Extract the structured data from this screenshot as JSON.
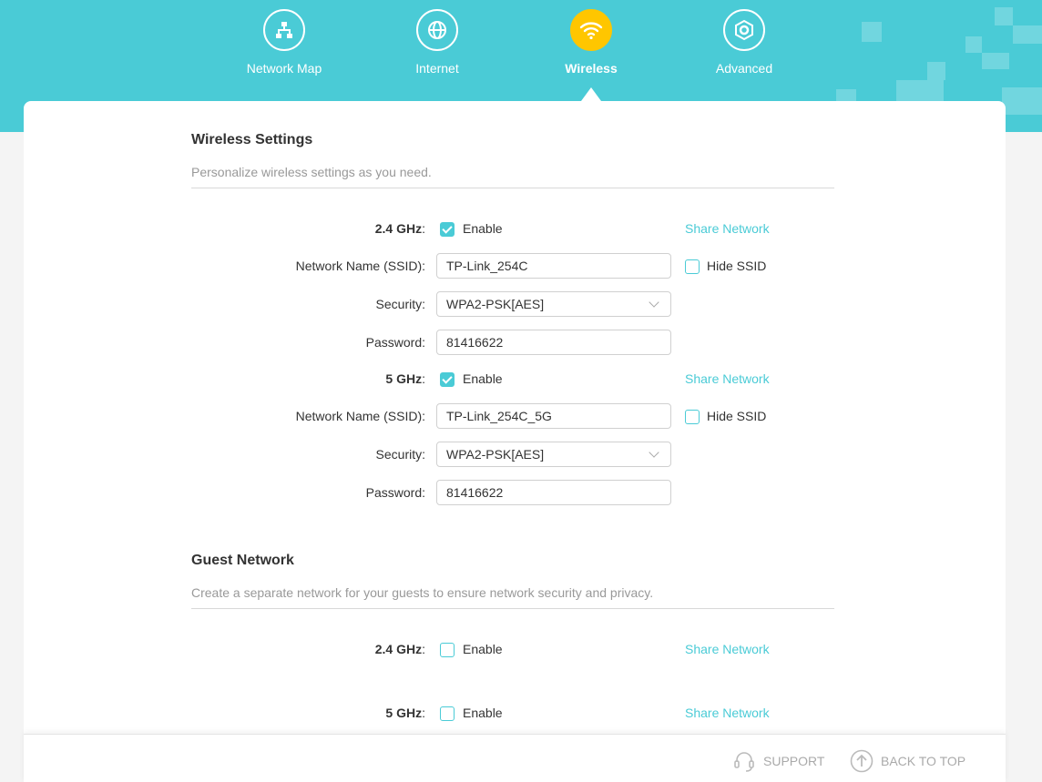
{
  "nav": {
    "items": [
      {
        "label": "Network Map",
        "icon": "network-map-icon"
      },
      {
        "label": "Internet",
        "icon": "globe-icon"
      },
      {
        "label": "Wireless",
        "icon": "wifi-icon",
        "active": true
      },
      {
        "label": "Advanced",
        "icon": "gear-icon"
      }
    ]
  },
  "colors": {
    "accent": "#4acbd6",
    "active_nav": "#ffc600"
  },
  "wireless": {
    "title": "Wireless Settings",
    "desc": "Personalize wireless settings as you need.",
    "band24": {
      "band": "2.4 GHz",
      "enable_label": "Enable",
      "enabled": true,
      "share": "Share Network",
      "ssid_label": "Network Name (SSID):",
      "ssid": "TP-Link_254C",
      "hide_label": "Hide SSID",
      "hidden": false,
      "security_label": "Security:",
      "security": "WPA2-PSK[AES]",
      "password_label": "Password:",
      "password": "81416622"
    },
    "band5": {
      "band": "5 GHz",
      "enable_label": "Enable",
      "enabled": true,
      "share": "Share Network",
      "ssid_label": "Network Name (SSID):",
      "ssid": "TP-Link_254C_5G",
      "hide_label": "Hide SSID",
      "hidden": false,
      "security_label": "Security:",
      "security": "WPA2-PSK[AES]",
      "password_label": "Password:",
      "password": "81416622"
    }
  },
  "guest": {
    "title": "Guest Network",
    "desc": "Create a separate network for your guests to ensure network security and privacy.",
    "band24": {
      "band": "2.4 GHz",
      "enable_label": "Enable",
      "enabled": false,
      "share": "Share Network"
    },
    "band5": {
      "band": "5 GHz",
      "enable_label": "Enable",
      "enabled": false,
      "share": "Share Network"
    }
  },
  "footer": {
    "support": "SUPPORT",
    "back_to_top": "BACK TO TOP"
  }
}
